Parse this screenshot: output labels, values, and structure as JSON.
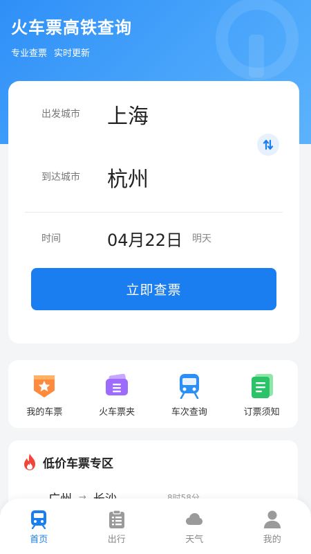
{
  "header": {
    "title": "火车票高铁查询",
    "tags": [
      "专业查票",
      "实时更新"
    ]
  },
  "search": {
    "from_label": "出发城市",
    "from_city": "上海",
    "to_label": "到达城市",
    "to_city": "杭州",
    "time_label": "时间",
    "date": "04月22日",
    "date_note": "明天",
    "button": "立即查票"
  },
  "quick_actions": [
    {
      "label": "我的车票",
      "icon": "ticket-badge-icon"
    },
    {
      "label": "火车票夹",
      "icon": "ticket-wallet-icon"
    },
    {
      "label": "车次查询",
      "icon": "train-icon"
    },
    {
      "label": "订票须知",
      "icon": "document-icon"
    }
  ],
  "deals": {
    "title": "低价车票专区",
    "route_from": "广州",
    "route_to": "长沙",
    "duration": "8时58分"
  },
  "tabs": [
    {
      "label": "首页",
      "active": true
    },
    {
      "label": "出行",
      "active": false
    },
    {
      "label": "天气",
      "active": false
    },
    {
      "label": "我的",
      "active": false
    }
  ],
  "colors": {
    "primary": "#1a7df0",
    "header_gradient_start": "#2f8ff7",
    "tab_active": "#1a7df0"
  }
}
